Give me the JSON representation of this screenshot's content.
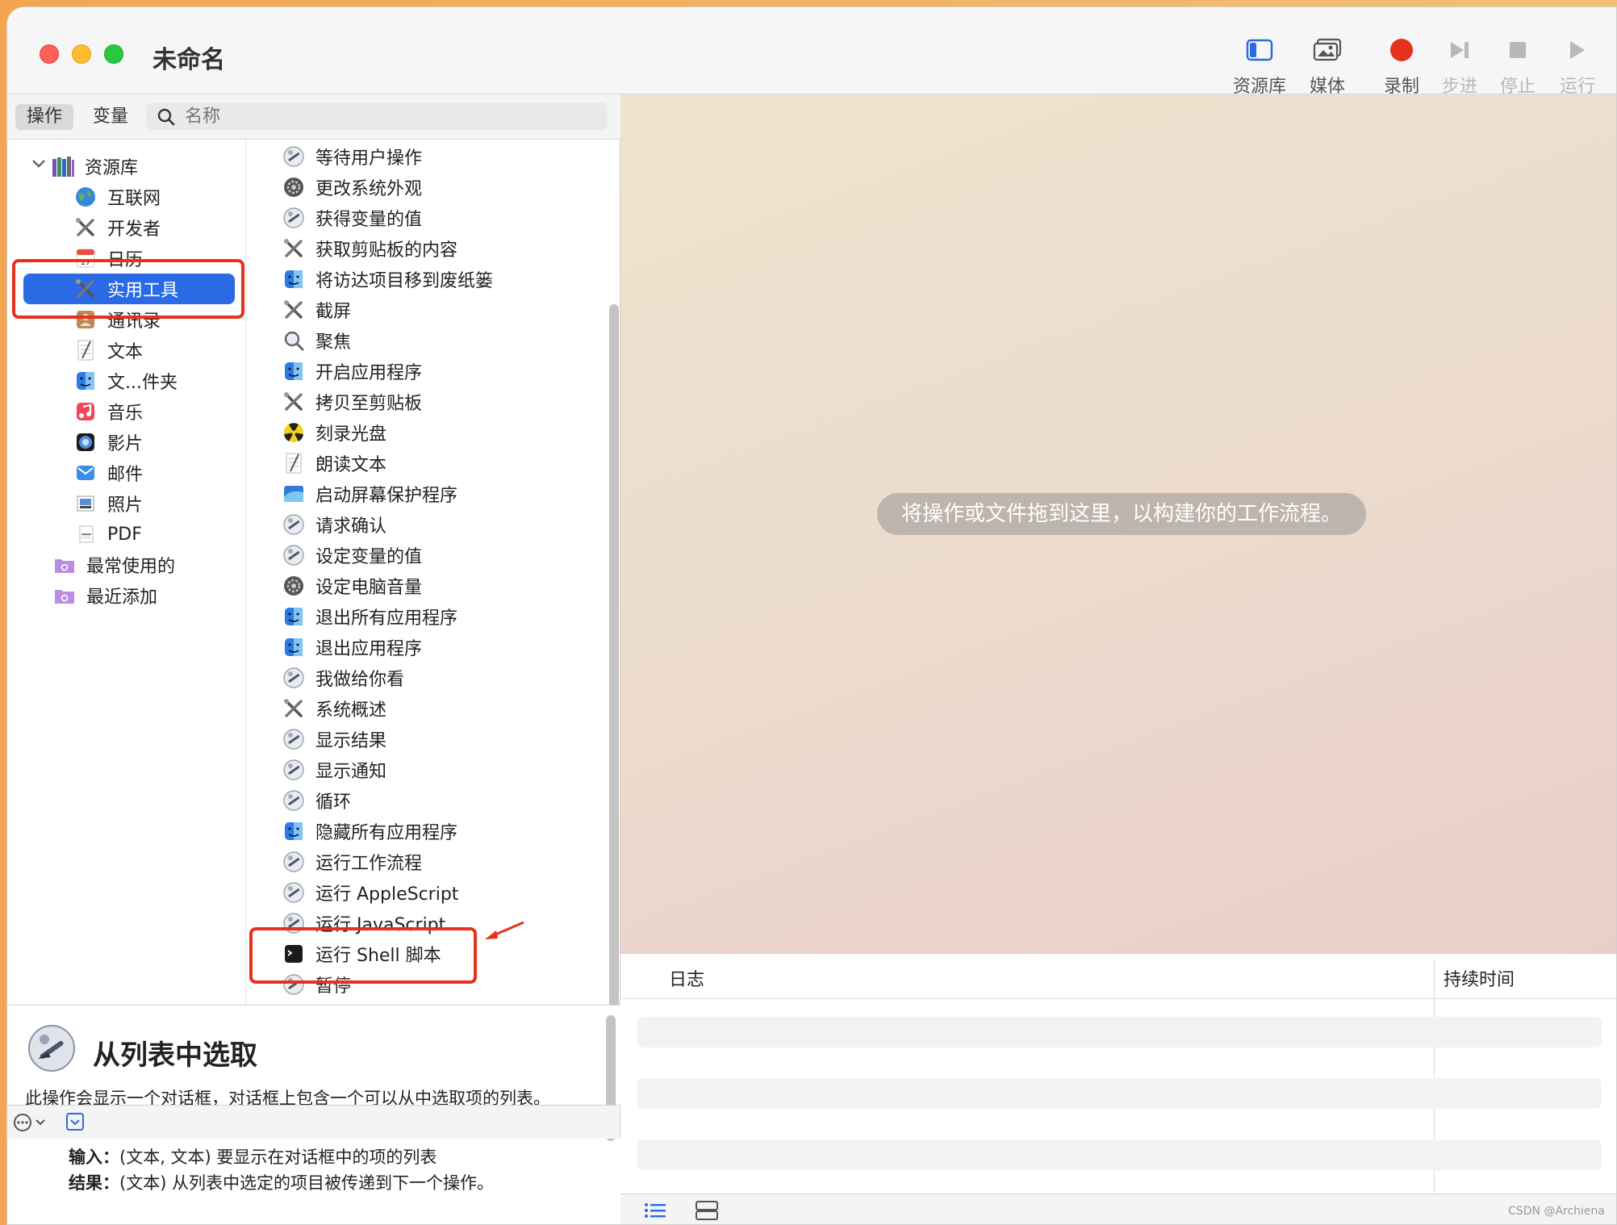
{
  "window": {
    "title": "未命名"
  },
  "toolbar": {
    "library": "资源库",
    "media": "媒体",
    "record": "录制",
    "step": "步进",
    "stop": "停止",
    "run": "运行"
  },
  "sidebar": {
    "tab_actions": "操作",
    "tab_variables": "变量",
    "search_placeholder": "名称"
  },
  "library": {
    "root": "资源库",
    "items": [
      {
        "label": "互联网",
        "icon": "globe-icon"
      },
      {
        "label": "开发者",
        "icon": "tools-icon"
      },
      {
        "label": "日历",
        "icon": "calendar-icon"
      },
      {
        "label": "实用工具",
        "icon": "tools-icon",
        "selected": true
      },
      {
        "label": "通讯录",
        "icon": "contacts-icon"
      },
      {
        "label": "文本",
        "icon": "text-icon"
      },
      {
        "label": "文...件夹",
        "icon": "finder-icon"
      },
      {
        "label": "音乐",
        "icon": "music-icon"
      },
      {
        "label": "影片",
        "icon": "movie-icon"
      },
      {
        "label": "邮件",
        "icon": "mail-icon"
      },
      {
        "label": "照片",
        "icon": "photo-icon"
      },
      {
        "label": "PDF",
        "icon": "pdf-icon"
      }
    ],
    "smart_folders": [
      {
        "label": "最常使用的",
        "icon": "smart-folder-icon"
      },
      {
        "label": "最近添加",
        "icon": "smart-folder-icon"
      }
    ]
  },
  "actions": [
    {
      "label": "等待用户操作",
      "icon": "automator-icon"
    },
    {
      "label": "更改系统外观",
      "icon": "system-prefs-icon"
    },
    {
      "label": "获得变量的值",
      "icon": "automator-icon"
    },
    {
      "label": "获取剪贴板的内容",
      "icon": "tools-icon"
    },
    {
      "label": "将访达项目移到废纸篓",
      "icon": "finder-icon"
    },
    {
      "label": "截屏",
      "icon": "tools-icon"
    },
    {
      "label": "聚焦",
      "icon": "spotlight-icon"
    },
    {
      "label": "开启应用程序",
      "icon": "finder-icon"
    },
    {
      "label": "拷贝至剪贴板",
      "icon": "tools-icon"
    },
    {
      "label": "刻录光盘",
      "icon": "burn-icon"
    },
    {
      "label": "朗读文本",
      "icon": "text-icon"
    },
    {
      "label": "启动屏幕保护程序",
      "icon": "screensaver-icon"
    },
    {
      "label": "请求确认",
      "icon": "automator-icon"
    },
    {
      "label": "设定变量的值",
      "icon": "automator-icon"
    },
    {
      "label": "设定电脑音量",
      "icon": "system-prefs-icon"
    },
    {
      "label": "退出所有应用程序",
      "icon": "finder-icon"
    },
    {
      "label": "退出应用程序",
      "icon": "finder-icon"
    },
    {
      "label": "我做给你看",
      "icon": "automator-icon"
    },
    {
      "label": "系统概述",
      "icon": "tools-icon"
    },
    {
      "label": "显示结果",
      "icon": "automator-icon"
    },
    {
      "label": "显示通知",
      "icon": "automator-icon"
    },
    {
      "label": "循环",
      "icon": "automator-icon"
    },
    {
      "label": "隐藏所有应用程序",
      "icon": "finder-icon"
    },
    {
      "label": "运行工作流程",
      "icon": "automator-icon"
    },
    {
      "label": "运行 AppleScript",
      "icon": "automator-icon"
    },
    {
      "label": "运行 JavaScript",
      "icon": "automator-icon"
    },
    {
      "label": "运行 Shell 脚本",
      "icon": "terminal-icon"
    },
    {
      "label": "暂停",
      "icon": "automator-icon"
    }
  ],
  "description": {
    "title": "从列表中选取",
    "body": "此操作会显示一个对话框，对话框上包含一个可以从中选取项的列表。",
    "input_label": "输入：",
    "input_value": "(文本, 文本) 要显示在对话框中的项的列表",
    "result_label": "结果：",
    "result_value": "(文本) 从列表中选定的项目被传递到下一个操作。"
  },
  "workflow": {
    "hint": "将操作或文件拖到这里，以构建你的工作流程。"
  },
  "log": {
    "col_log": "日志",
    "col_duration": "持续时间"
  },
  "watermark": "CSDN @Archiena",
  "colors": {
    "selection": "#2b6ae5",
    "record": "#e5321c",
    "annotation": "#e5321c"
  }
}
